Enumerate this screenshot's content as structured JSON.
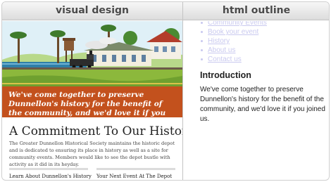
{
  "header": {
    "left_label": "visual design",
    "right_label": "html outline"
  },
  "design": {
    "banner": "We've come together to preserve Dunnellon's history for the benefit of the community, and we'd love it if you joined us.",
    "title": "A Commitment To Our History",
    "body": "The Greater Dunnellon Historical Society maintains the historic depot and is dedicated to ensuring its place in history as well as a site for community events. Members would like to see the depot bustle with activity as it did in its heyday.",
    "sub_left": "Learn About Dunnellon's History",
    "sub_right": "Your Next Event At The Depot"
  },
  "outline": {
    "nav": [
      "Community Events",
      "Book your event",
      "History",
      "About us",
      "Contact us"
    ],
    "heading": "Introduction",
    "body": "We've come together to preserve Dunnellon's history for the benefit of the community, and we'd love it if you joined us."
  },
  "colors": {
    "banner": "#c3511d",
    "link": "#c9c9ef",
    "sky": "#dff0f7",
    "grass": "#8cb83c",
    "water": "#2f7fa8"
  }
}
